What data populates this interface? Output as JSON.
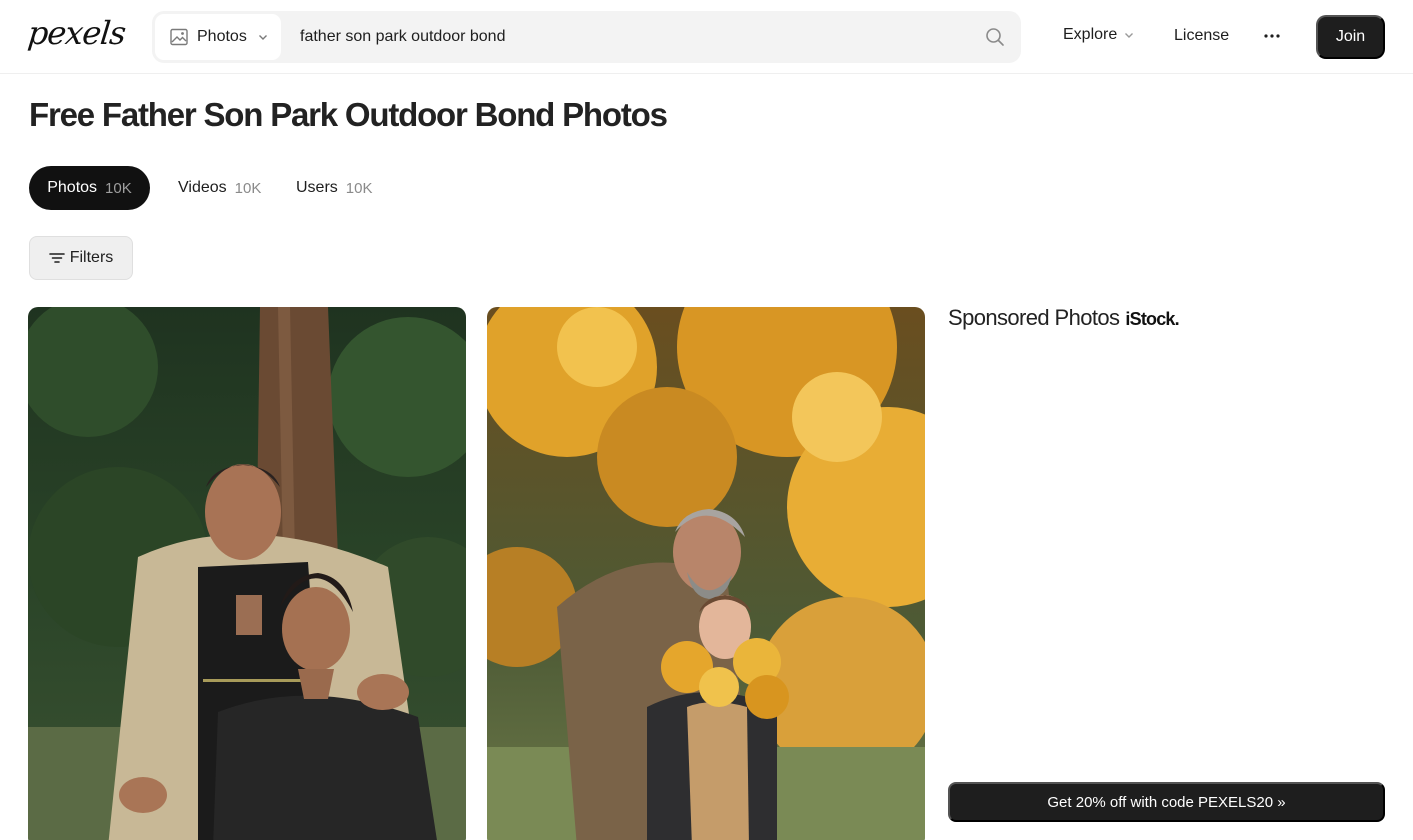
{
  "header": {
    "logo_text": "pexels",
    "search_type": "Photos",
    "search_value": "father son park outdoor bond",
    "nav_explore": "Explore",
    "nav_license": "License",
    "nav_more": "···",
    "join_label": "Join",
    "icons": [
      "image-icon",
      "chevron-down-icon",
      "search-icon",
      "more-icon"
    ]
  },
  "page": {
    "title": "Free Father Son Park Outdoor Bond Photos"
  },
  "tabs": [
    {
      "label": "Photos",
      "count": "10K",
      "active": true
    },
    {
      "label": "Videos",
      "count": "10K",
      "active": false
    },
    {
      "label": "Users",
      "count": "10K",
      "active": false
    }
  ],
  "filters": {
    "label": "Filters",
    "icon": "filter-icon"
  },
  "sponsored": {
    "title": "Sponsored Photos",
    "brand": "iStock.",
    "promo_label": "Get 20% off with code PEXELS20 »"
  },
  "colors": {
    "dark_button": "#1e1e1e",
    "search_bg": "#f3f3f3",
    "muted_count": "#8a8a8a"
  }
}
